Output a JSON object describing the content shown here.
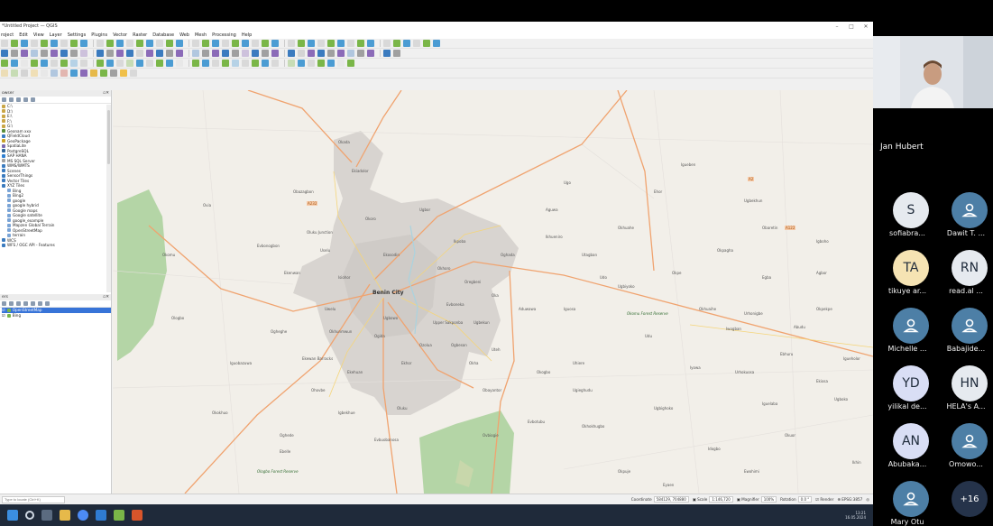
{
  "qgis": {
    "window_title": "*Untitled Project — QGIS",
    "menu": [
      "roject",
      "Edit",
      "View",
      "Layer",
      "Settings",
      "Plugins",
      "Vector",
      "Raster",
      "Database",
      "Web",
      "Mesh",
      "Processing",
      "Help"
    ],
    "browser_panel": {
      "title": "owser",
      "items": [
        {
          "label": "C:\\",
          "indent": 0,
          "icon_color": "#caa646"
        },
        {
          "label": "D:\\",
          "indent": 0,
          "icon_color": "#caa646"
        },
        {
          "label": "E:\\",
          "indent": 0,
          "icon_color": "#caa646"
        },
        {
          "label": "F:\\",
          "indent": 0,
          "icon_color": "#caa646"
        },
        {
          "label": "G:\\",
          "indent": 0,
          "icon_color": "#caa646"
        },
        {
          "label": "Geonam xxx",
          "indent": 0,
          "icon_color": "#5a8f3b"
        },
        {
          "label": "QFieldCloud",
          "indent": 0,
          "icon_color": "#3b7bbf"
        },
        {
          "label": "GeoPackage",
          "indent": 0,
          "icon_color": "#c9a227"
        },
        {
          "label": "SpatiaLite",
          "indent": 0,
          "icon_color": "#7b6ab0"
        },
        {
          "label": "PostgreSQL",
          "indent": 0,
          "icon_color": "#336699"
        },
        {
          "label": "SAP HANA",
          "indent": 0,
          "icon_color": "#2f7fd1"
        },
        {
          "label": "MS SQL Server",
          "indent": 0,
          "icon_color": "#a0a0a0"
        },
        {
          "label": "WMS/WMTS",
          "indent": 0,
          "icon_color": "#3b7bbf"
        },
        {
          "label": "Scenes",
          "indent": 0,
          "icon_color": "#3b7bbf"
        },
        {
          "label": "SensorThings",
          "indent": 0,
          "icon_color": "#3b7bbf"
        },
        {
          "label": "Vector Tiles",
          "indent": 0,
          "icon_color": "#3b7bbf"
        },
        {
          "label": "XYZ Tiles",
          "indent": 0,
          "icon_color": "#3b7bbf"
        },
        {
          "label": "Bing",
          "indent": 1,
          "icon_color": "#7aa4d6"
        },
        {
          "label": "Bing2",
          "indent": 1,
          "icon_color": "#7aa4d6"
        },
        {
          "label": "google",
          "indent": 1,
          "icon_color": "#7aa4d6"
        },
        {
          "label": "google hybrid",
          "indent": 1,
          "icon_color": "#7aa4d6"
        },
        {
          "label": "Google maps",
          "indent": 1,
          "icon_color": "#7aa4d6"
        },
        {
          "label": "Google satellite",
          "indent": 1,
          "icon_color": "#7aa4d6"
        },
        {
          "label": "google_example",
          "indent": 1,
          "icon_color": "#7aa4d6"
        },
        {
          "label": "Mapzen Global Terrain",
          "indent": 1,
          "icon_color": "#7aa4d6"
        },
        {
          "label": "OpenStreetMap",
          "indent": 1,
          "icon_color": "#7aa4d6"
        },
        {
          "label": "terrain",
          "indent": 1,
          "icon_color": "#7aa4d6"
        },
        {
          "label": "WCS",
          "indent": 0,
          "icon_color": "#3b7bbf"
        },
        {
          "label": "WFS / OGC API - Features",
          "indent": 0,
          "icon_color": "#3b7bbf"
        }
      ]
    },
    "layers_panel": {
      "title": "ers",
      "items": [
        {
          "label": "OpenStreetMap",
          "selected": true
        },
        {
          "label": "Bing",
          "selected": false
        }
      ]
    },
    "map": {
      "labels": [
        {
          "text": "Benin City",
          "kind": "city"
        },
        {
          "text": "Ekiadolor",
          "kind": "place"
        },
        {
          "text": "Okada",
          "kind": "place"
        },
        {
          "text": "Uselu",
          "kind": "place"
        },
        {
          "text": "Ugbowo",
          "kind": "place"
        },
        {
          "text": "Ikpoba",
          "kind": "place"
        },
        {
          "text": "Uteh",
          "kind": "place"
        },
        {
          "text": "Obayantor",
          "kind": "place"
        },
        {
          "text": "Abudu",
          "kind": "place"
        },
        {
          "text": "Iguelaba",
          "kind": "place"
        },
        {
          "text": "Oluku",
          "kind": "place"
        },
        {
          "text": "Ugbiyoko",
          "kind": "place"
        },
        {
          "text": "Ogheghe",
          "kind": "place"
        },
        {
          "text": "Okha",
          "kind": "place"
        },
        {
          "text": "Iguosa",
          "kind": "place"
        },
        {
          "text": "Udo",
          "kind": "place"
        },
        {
          "text": "Ologbo",
          "kind": "place"
        },
        {
          "text": "Urhonigbe",
          "kind": "place"
        },
        {
          "text": "Iyowa",
          "kind": "place"
        },
        {
          "text": "Egba",
          "kind": "place"
        },
        {
          "text": "Okomu",
          "kind": "place"
        },
        {
          "text": "Iguobazuwa",
          "kind": "place"
        },
        {
          "text": "Okhuahe",
          "kind": "place"
        },
        {
          "text": "Ehor",
          "kind": "place"
        },
        {
          "text": "Igueben",
          "kind": "place"
        },
        {
          "text": "Ugo",
          "kind": "place"
        },
        {
          "text": "Ekenwan",
          "kind": "place"
        },
        {
          "text": "Evbonogbon",
          "kind": "place"
        },
        {
          "text": "Ovia",
          "kind": "place"
        },
        {
          "text": "Okokhuo",
          "kind": "place"
        },
        {
          "text": "Ekewan Barracks",
          "kind": "place"
        },
        {
          "text": "Ikhueniro",
          "kind": "place"
        },
        {
          "text": "Utagban",
          "kind": "place"
        },
        {
          "text": "Agbor",
          "kind": "place"
        },
        {
          "text": "Obaretin",
          "kind": "place"
        },
        {
          "text": "Okhoro",
          "kind": "place"
        },
        {
          "text": "Ekosodin",
          "kind": "place"
        },
        {
          "text": "Oregbeni",
          "kind": "place"
        },
        {
          "text": "Evboneka",
          "kind": "place"
        },
        {
          "text": "Ugbor",
          "kind": "place"
        },
        {
          "text": "Okoro",
          "kind": "place"
        },
        {
          "text": "Obazagbon",
          "kind": "place"
        },
        {
          "text": "Okhunmwun",
          "kind": "place"
        },
        {
          "text": "Ekehuan",
          "kind": "place"
        },
        {
          "text": "Oghede",
          "kind": "place"
        },
        {
          "text": "Ohovbe",
          "kind": "place"
        },
        {
          "text": "Igbekhue",
          "kind": "place"
        },
        {
          "text": "Evbuobanosa",
          "kind": "place"
        },
        {
          "text": "Ozolua",
          "kind": "place"
        },
        {
          "text": "Oghada",
          "kind": "place"
        },
        {
          "text": "Okogbo",
          "kind": "place"
        },
        {
          "text": "Ugieghudu",
          "kind": "place"
        },
        {
          "text": "Aduwawa",
          "kind": "place"
        },
        {
          "text": "Ugbekun",
          "kind": "place"
        },
        {
          "text": "Oka",
          "kind": "place"
        },
        {
          "text": "Upper Sakponba",
          "kind": "place"
        },
        {
          "text": "Ogida",
          "kind": "place"
        },
        {
          "text": "Uwelu",
          "kind": "place"
        },
        {
          "text": "Isiohor",
          "kind": "place"
        },
        {
          "text": "Oluku Junction",
          "kind": "place"
        },
        {
          "text": "Ekhor",
          "kind": "place"
        },
        {
          "text": "Ogbeson",
          "kind": "place"
        },
        {
          "text": "Evbotubu",
          "kind": "place"
        },
        {
          "text": "Ovbiogie",
          "kind": "place"
        },
        {
          "text": "Okhokhugbo",
          "kind": "place"
        },
        {
          "text": "Ugbighoko",
          "kind": "place"
        },
        {
          "text": "Idogbo",
          "kind": "place"
        },
        {
          "text": "Ewohimi",
          "kind": "place"
        },
        {
          "text": "Okuor",
          "kind": "place"
        },
        {
          "text": "Ekiosa",
          "kind": "place"
        },
        {
          "text": "Ugboko",
          "kind": "place"
        },
        {
          "text": "Ikhin",
          "kind": "place"
        },
        {
          "text": "Okpuje",
          "kind": "place"
        },
        {
          "text": "Eyaen",
          "kind": "place"
        },
        {
          "text": "Okhuaihe",
          "kind": "place"
        },
        {
          "text": "Urhokuosa",
          "kind": "place"
        },
        {
          "text": "Ebhuru",
          "kind": "place"
        },
        {
          "text": "Udu",
          "kind": "place"
        },
        {
          "text": "Okpe",
          "kind": "place"
        },
        {
          "text": "Okpagha",
          "kind": "place"
        },
        {
          "text": "Ugbekhun",
          "kind": "place"
        },
        {
          "text": "Ebelle",
          "kind": "place"
        },
        {
          "text": "Ologbo Forest Reserve",
          "kind": "park"
        },
        {
          "text": "Okomu Forest Reserve",
          "kind": "park"
        },
        {
          "text": "Aguwa",
          "kind": "place"
        },
        {
          "text": "Uhiere",
          "kind": "place"
        },
        {
          "text": "Okpekpe",
          "kind": "place"
        },
        {
          "text": "Igboho",
          "kind": "place"
        },
        {
          "text": "Igueholor",
          "kind": "place"
        },
        {
          "text": "Iwogban",
          "kind": "place"
        },
        {
          "text": "A232",
          "kind": "road"
        },
        {
          "text": "A122",
          "kind": "road"
        },
        {
          "text": "A2",
          "kind": "road"
        }
      ]
    },
    "status_bar": {
      "locator_placeholder": "Type to locate (Ctrl+K)",
      "coordinate_label": "Coordinate",
      "coordinate_value": "584129, 704880",
      "scale_label": "Scale",
      "scale_value": "1:146,720",
      "magnifier_label": "Magnifier",
      "magnifier_value": "100%",
      "rotation_label": "Rotation",
      "rotation_value": "0.0 °",
      "render_label": "Render",
      "crs": "EPSG:3857"
    },
    "taskbar": {
      "time": "13:21",
      "date": "16.05.2024"
    }
  },
  "meeting": {
    "speaker": "Jan Hubert",
    "participants": [
      {
        "initials": "S",
        "name": "sofiabra...",
        "style": "light"
      },
      {
        "initials": "",
        "name": "Dawit T. ...",
        "style": "person"
      },
      {
        "initials": "TA",
        "name": "tikuye ar...",
        "style": "yellow"
      },
      {
        "initials": "RN",
        "name": "read.al ...",
        "style": "light"
      },
      {
        "initials": "",
        "name": "Michelle ...",
        "style": "person"
      },
      {
        "initials": "",
        "name": "Babajide...",
        "style": "person"
      },
      {
        "initials": "YD",
        "name": "yilikal de...",
        "style": "lavender"
      },
      {
        "initials": "HN",
        "name": "HELA's A...",
        "style": "light"
      },
      {
        "initials": "AN",
        "name": "Abubaka...",
        "style": "lavender"
      },
      {
        "initials": "",
        "name": "Omowo...",
        "style": "person"
      },
      {
        "initials": "",
        "name": "Mary Otu",
        "style": "person"
      },
      {
        "initials": "+16",
        "name": "",
        "style": "more"
      }
    ]
  }
}
